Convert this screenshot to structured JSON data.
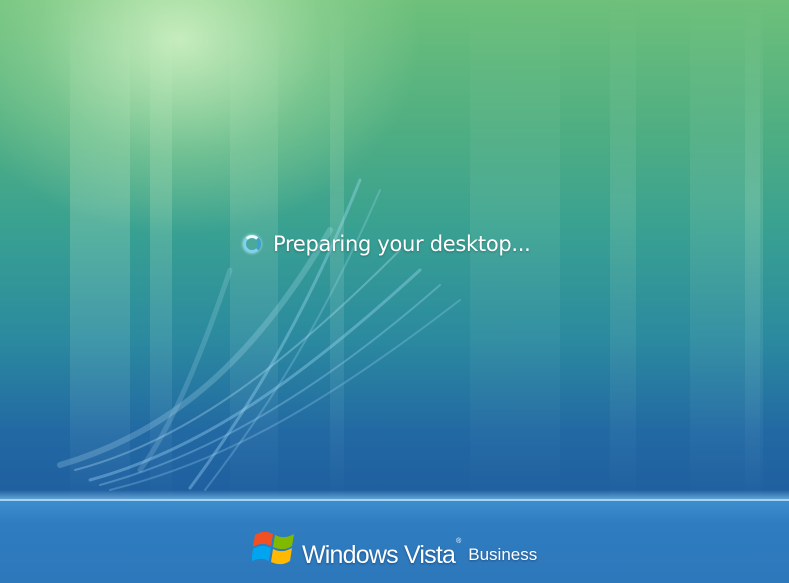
{
  "status": {
    "message": "Preparing your desktop...",
    "icon": "busy-spinner-icon"
  },
  "branding": {
    "product": "Windows Vista",
    "trademark": "®",
    "edition": "Business",
    "logo": "windows-flag-icon",
    "logo_colors": [
      "#f25022",
      "#7fba00",
      "#00a4ef",
      "#ffb900"
    ]
  },
  "theme": {
    "background_top": "#6ec07a",
    "background_bottom": "#1f5fa0",
    "text_color": "#ffffff"
  }
}
